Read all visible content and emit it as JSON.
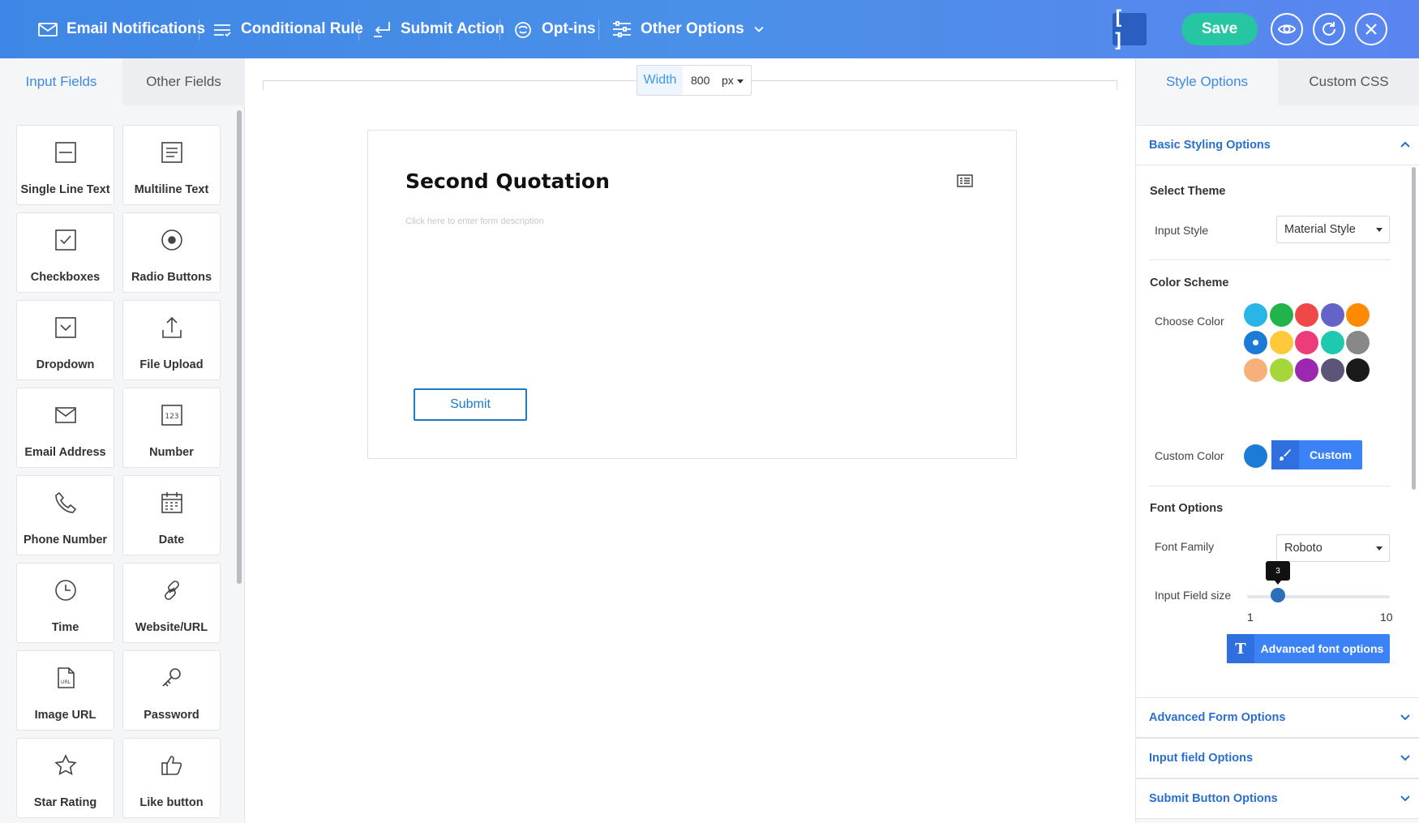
{
  "header": {
    "nav": [
      {
        "label": "Email Notifications",
        "icon": "envelope-icon"
      },
      {
        "label": "Conditional Rule",
        "icon": "checklist-icon"
      },
      {
        "label": "Submit Action",
        "icon": "return-arrow-icon"
      },
      {
        "label": "Opt-ins",
        "icon": "stamp-icon"
      },
      {
        "label": "Other Options",
        "icon": "sliders-icon"
      }
    ],
    "shortcode_label": "[ ]",
    "save_label": "Save",
    "colors": {
      "gradient_start": "#3f87e6",
      "gradient_end": "#5a85f0",
      "save": "#26c6a2"
    }
  },
  "left_panel": {
    "tabs": [
      "Input Fields",
      "Other Fields"
    ],
    "active_tab": "Input Fields",
    "fields": [
      {
        "label": "Single Line Text",
        "icon": "single-line-icon"
      },
      {
        "label": "Multiline Text",
        "icon": "multiline-icon"
      },
      {
        "label": "Checkboxes",
        "icon": "checkbox-icon"
      },
      {
        "label": "Radio Buttons",
        "icon": "radio-icon"
      },
      {
        "label": "Dropdown",
        "icon": "dropdown-icon"
      },
      {
        "label": "File Upload",
        "icon": "upload-icon"
      },
      {
        "label": "Email Address",
        "icon": "email-icon"
      },
      {
        "label": "Number",
        "icon": "number-icon"
      },
      {
        "label": "Phone Number",
        "icon": "phone-icon"
      },
      {
        "label": "Date",
        "icon": "calendar-icon"
      },
      {
        "label": "Time",
        "icon": "clock-icon"
      },
      {
        "label": "Website/URL",
        "icon": "link-icon"
      },
      {
        "label": "Image URL",
        "icon": "image-url-icon"
      },
      {
        "label": "Password",
        "icon": "key-icon"
      },
      {
        "label": "Star Rating",
        "icon": "star-icon"
      },
      {
        "label": "Like button",
        "icon": "thumbs-up-icon"
      }
    ]
  },
  "canvas": {
    "width_label": "Width",
    "width_value": "800",
    "width_unit": "px",
    "form_title": "Second Quotation",
    "form_description_placeholder": "Click here to enter form description",
    "submit_label": "Submit"
  },
  "right_panel": {
    "tabs": [
      "Style Options",
      "Custom CSS"
    ],
    "active_tab": "Style Options",
    "basic_styling": {
      "title": "Basic Styling Options",
      "select_theme_title": "Select Theme",
      "input_style_label": "Input Style",
      "input_style_value": "Material Style",
      "color_scheme_title": "Color Scheme",
      "choose_color_label": "Choose Color",
      "colors": [
        "#29b6e6",
        "#22b34a",
        "#f04848",
        "#6464c8",
        "#ff8a00",
        "#1b7bd6",
        "#ffc93a",
        "#ec3c7a",
        "#1ec9b0",
        "#888888",
        "#f7b07a",
        "#a5d63a",
        "#9c27b0",
        "#5d5578",
        "#1a1a1a"
      ],
      "selected_color": "#1b7bd6",
      "custom_color_label": "Custom Color",
      "custom_color_value": "#1b7bd6",
      "custom_button_label": "Custom",
      "font_options_title": "Font Options",
      "font_family_label": "Font Family",
      "font_family_value": "Roboto",
      "input_field_size_label": "Input Field size",
      "input_field_size_value": "3",
      "slider_min": "1",
      "slider_max": "10",
      "advanced_font_label": "Advanced font options"
    },
    "sections": [
      "Advanced Form Options",
      "Input field Options",
      "Submit Button Options"
    ]
  }
}
